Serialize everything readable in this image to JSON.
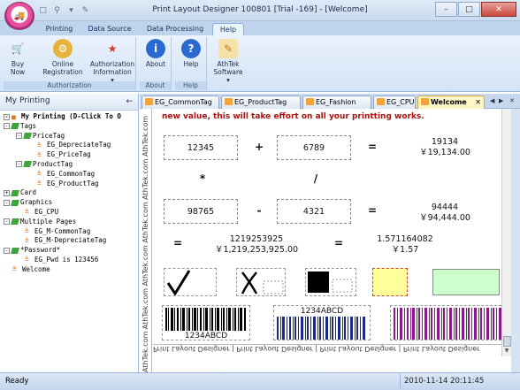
{
  "window": {
    "title": "Print Layout Designer 100801 [Trial -169] - [Welcome]",
    "minimize_glyph": "–",
    "maximize_glyph": "□",
    "close_glyph": "✕"
  },
  "ribbon_tabs": [
    "Printing",
    "Data Source",
    "Data Processing",
    "Help"
  ],
  "ribbon": {
    "buy_label": "Buy Now",
    "online_reg_label": "Online Registration",
    "auth_info_label": "Authorization Information",
    "group_authorization": "Authorization",
    "about_label": "About",
    "group_about": "About",
    "help_label": "Help",
    "group_help": "Help",
    "athtek_label": "AthTek Software",
    "dropdown_glyph": "▾"
  },
  "left_panel": {
    "title": "My Printing",
    "pin_glyph": "←",
    "tree": [
      "My Printing (D-Click To O",
      "Tags",
      "PriceTag",
      "EG_DepreciateTag",
      "EG_PriceTag",
      "ProductTag",
      "EG_CommonTag",
      "EG_ProductTag",
      "Card",
      "Graphics",
      "EG_CPU",
      "Multiple Pages",
      "EG_M-CommonTag",
      "EG_M-DepreciateTag",
      "*Password*",
      "EG_Pwd is 123456",
      "Welcome"
    ]
  },
  "doc_tabs": [
    "EG_CommonTag",
    "EG_ProductTag",
    "EG_Fashion",
    "EG_CPU",
    "Welcome"
  ],
  "canvas": {
    "note": "new value, this will take effort on all your printting works.",
    "num_a": "12345",
    "op_plus": "+",
    "num_b": "6789",
    "eq1": "=",
    "sum": "19134",
    "sum_currency": "￥19,134.00",
    "op_mul": "*",
    "op_div": "/",
    "num_c": "98765",
    "op_minus": "-",
    "num_d": "4321",
    "eq2": "=",
    "diff": "94444",
    "diff_currency": "￥94,444.00",
    "eq3": "=",
    "product": "1219253925",
    "product_currency": "￥1,219,253,925.00",
    "eq4": "=",
    "quotient": "1.571164082",
    "quotient_currency": "￥1.57",
    "barcode1": "1234ABCD",
    "barcode2": "1234ABCD",
    "side_ruler": "AthTek.com AthTek.com AthTek.com AthTek.com AthTek.com AthTek.com",
    "bottom_ruler": "Print Layout Designer | Print Layout Designer | Print Layout Designer | Print Layout Designer"
  },
  "status": {
    "ready": "Ready",
    "timestamp": "2010-11-14 20:11:45"
  }
}
